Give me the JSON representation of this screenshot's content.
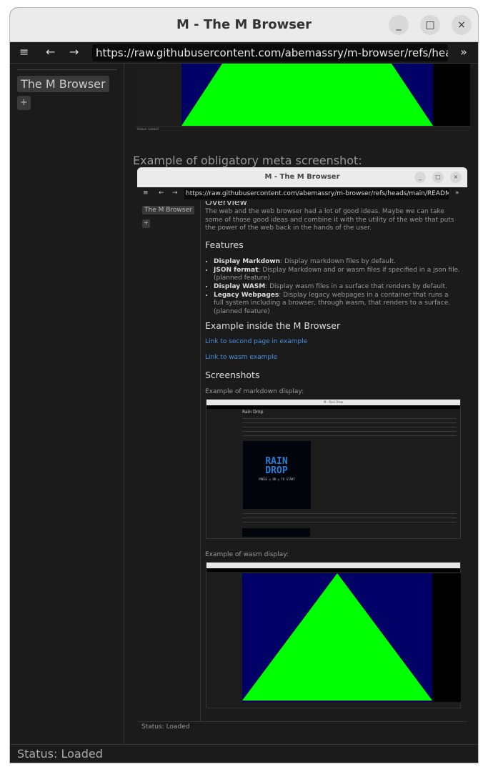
{
  "window": {
    "title": "M - The M Browser",
    "minimize": "_",
    "maximize": "□",
    "close": "×"
  },
  "toolbar": {
    "url": "https://raw.githubusercontent.com/abemassry/m-browser/refs/heads/main/README.md",
    "menu_icon": "≡",
    "back_icon": "←",
    "forward_icon": "→",
    "overflow_icon": "»"
  },
  "sidebar": {
    "tabs": [
      {
        "label": "The M Browser"
      }
    ],
    "new_tab": "+"
  },
  "content": {
    "prev_status": "Status: Loaded",
    "meta_caption": "Example of obligatory meta screenshot:",
    "colors": {
      "wasm_bg": "#000066",
      "triangle": "#00ff00",
      "link": "#4a90e2"
    }
  },
  "inner": {
    "title": "M - The M Browser",
    "url": "https://raw.githubusercontent.com/abemassry/m-browser/refs/heads/main/README.md",
    "tab": "The M Browser",
    "new_tab": "+",
    "overview_heading": "Overview",
    "overview_text": "The web and the web browser had a lot of good ideas. Maybe we can take some of those good ideas and combine it with the utility of the web that puts the power of the web back in the hands of the user.",
    "features_heading": "Features",
    "features": [
      {
        "name": "Display Markdown",
        "desc": ": Display markdown files by default."
      },
      {
        "name": "JSON format",
        "desc": ": Display Markdown and or wasm files if specified in a json file. (planned feature)"
      },
      {
        "name": "Display WASM",
        "desc": ": Display wasm files in a surface that renders by default."
      },
      {
        "name": "Legacy Webpages",
        "desc": ": Display legacy webpages in a container that runs a full system including a browser, through wasm, that renders to a surface. (planned feature)"
      }
    ],
    "example_heading": "Example inside the M Browser",
    "link1": "Link to second page in example",
    "link2": "Link to wasm example",
    "screenshots_heading": "Screenshots",
    "md_caption": "Example of markdown display:",
    "md_shot": {
      "title": "M - Rain Drop",
      "heading": "Rain Drop",
      "game_title": "RAIN DROP",
      "game_sub": "PRESS ◎ OR ◎ TO START"
    },
    "wasm_caption": "Example of wasm display:",
    "status": "Status: Loaded"
  },
  "status": "Status: Loaded"
}
